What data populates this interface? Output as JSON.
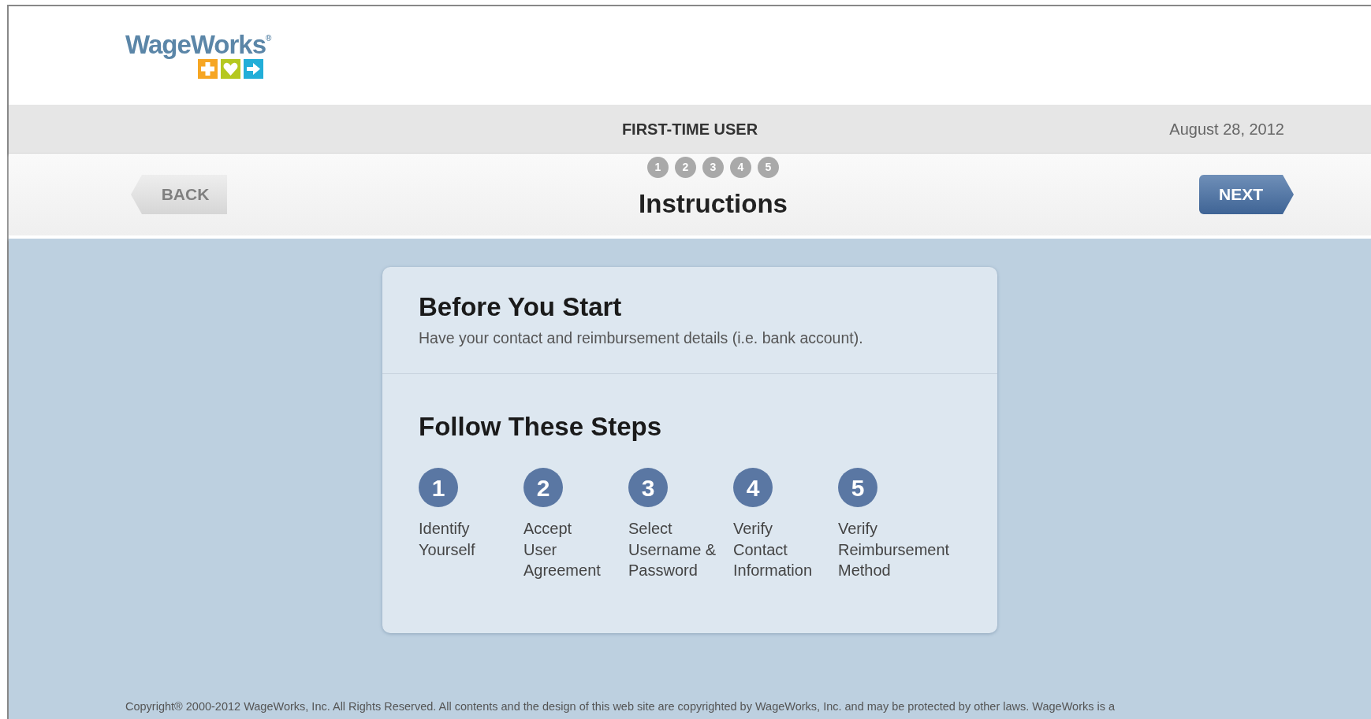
{
  "logo": {
    "text": "WageWorks$^{®}$"
  },
  "header": {
    "title": "FIRST-TIME USER",
    "date": "August 28, 2012"
  },
  "nav": {
    "back": "BACK",
    "next": "NEXT",
    "title": "Instructions",
    "progress": [
      "1",
      "2",
      "3",
      "4",
      "5"
    ]
  },
  "card": {
    "heading": "Before You Start",
    "text": "Have your contact and reimbursement details (i.e. bank account).",
    "steps_heading": "Follow These Steps",
    "steps": [
      {
        "number": "1",
        "label": "Identify\nYourself"
      },
      {
        "number": "2",
        "label": "Accept\nUser\nAgreement"
      },
      {
        "number": "3",
        "label": "Select\nUsername &\nPassword"
      },
      {
        "number": "4",
        "label": "Verify\nContact\nInformation"
      },
      {
        "number": "5",
        "label": "Verify\nReimbursement\nMethod"
      }
    ]
  },
  "footer": {
    "text": "Copyright® 2000-2012 WageWorks, Inc. All Rights Reserved. All contents and the design of this web site are copyrighted by WageWorks, Inc. and may be protected by other laws. WageWorks is a"
  }
}
